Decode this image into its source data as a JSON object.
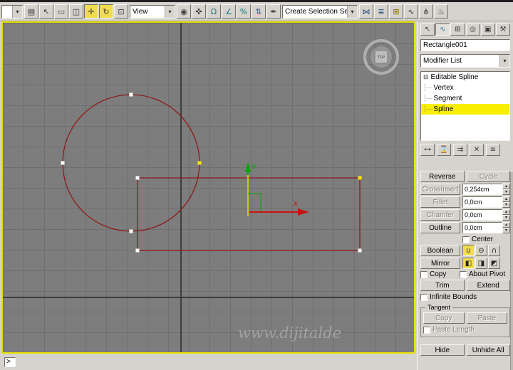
{
  "colors": {
    "viewport_border": "#e6df00",
    "spline_stroke": "#8e1b1b",
    "selected_vertex": "#f8e800",
    "selected_subobject_bg": "#f8f000",
    "active_button_bg": "#f0dc4e",
    "axis_x": "#cc1111",
    "axis_y": "#00a800"
  },
  "toolbar": {
    "filter_dropdown": {
      "value": ""
    },
    "view_dropdown": {
      "value": "View"
    },
    "selection_set_dropdown": {
      "value": "Create Selection Se"
    },
    "icons_a": [
      {
        "name": "select-by-name-icon",
        "glyph": "▤"
      },
      {
        "name": "select-object-icon",
        "glyph": "↖"
      },
      {
        "name": "rectangular-selection-region-icon",
        "glyph": "▭"
      },
      {
        "name": "window-crossing-icon",
        "glyph": "◫"
      },
      {
        "name": "select-and-move-icon",
        "glyph": "✛",
        "active": true
      },
      {
        "name": "select-and-rotate-icon",
        "glyph": "↻",
        "active": true
      },
      {
        "name": "select-and-scale-icon",
        "glyph": "⊡"
      }
    ],
    "icons_b": [
      {
        "name": "use-pivot-point-center-icon",
        "glyph": "◉"
      },
      {
        "name": "select-and-manipulate-icon",
        "glyph": "✜"
      },
      {
        "name": "snap-toggle-icon",
        "glyph": "Ω",
        "color": "#0e7e7e"
      },
      {
        "name": "angle-snap-icon",
        "glyph": "∠",
        "color": "#0e7e7e"
      },
      {
        "name": "percent-snap-icon",
        "glyph": "%",
        "color": "#0e7e7e"
      },
      {
        "name": "spinner-snap-icon",
        "glyph": "⇅",
        "color": "#0e7e7e"
      },
      {
        "name": "edit-named-selection-sets-icon",
        "glyph": "✒"
      }
    ],
    "icons_c": [
      {
        "name": "mirror-icon",
        "glyph": "⋈",
        "color": "#28527a"
      },
      {
        "name": "align-icon",
        "glyph": "≣",
        "color": "#28527a"
      },
      {
        "name": "layer-manager-icon",
        "glyph": "⊞",
        "color": "#8a6d00"
      },
      {
        "name": "curve-editor-icon",
        "glyph": "∿",
        "color": "#3a3a3a"
      },
      {
        "name": "schematic-view-icon",
        "glyph": "⋔",
        "color": "#3a3a3a"
      },
      {
        "name": "render-setup-icon",
        "glyph": "♨",
        "color": "#3a3a3a"
      }
    ]
  },
  "viewport": {
    "viewcube_label": "TOP",
    "axis_x_label": "x",
    "axis_y_label": "y",
    "watermark": "www.dijitalde"
  },
  "panel": {
    "tabs": [
      {
        "name": "create-tab",
        "glyph": "↖"
      },
      {
        "name": "modify-tab",
        "glyph": "∿",
        "active": true,
        "color": "#17728f"
      },
      {
        "name": "hierarchy-tab",
        "glyph": "⊞"
      },
      {
        "name": "motion-tab",
        "glyph": "◎"
      },
      {
        "name": "display-tab",
        "glyph": "▣"
      },
      {
        "name": "utilities-tab",
        "glyph": "⚒"
      }
    ],
    "object_name": "Rectangle001",
    "modifier_list_label": "Modifier List",
    "stack": {
      "root": "Editable Spline",
      "items": [
        "Vertex",
        "Segment",
        "Spline"
      ],
      "selected": "Spline"
    },
    "stack_tools": [
      {
        "name": "pin-stack-icon",
        "glyph": "⊶"
      },
      {
        "name": "show-end-result-icon",
        "glyph": "⌛"
      },
      {
        "name": "make-unique-icon",
        "glyph": "⇉"
      },
      {
        "name": "remove-modifier-icon",
        "glyph": "✕"
      },
      {
        "name": "configure-modifier-sets-icon",
        "glyph": "≡"
      }
    ],
    "boolean_icons": [
      {
        "name": "boolean-union-icon",
        "glyph": "∪",
        "active": true
      },
      {
        "name": "boolean-subtraction-icon",
        "glyph": "⊖"
      },
      {
        "name": "boolean-intersection-icon",
        "glyph": "∩"
      }
    ],
    "mirror_icons": [
      {
        "name": "mirror-horizontal-icon",
        "glyph": "◧",
        "active": true
      },
      {
        "name": "mirror-vertical-icon",
        "glyph": "◨"
      },
      {
        "name": "mirror-both-icon",
        "glyph": "◩"
      }
    ],
    "geometry": {
      "reverse": "Reverse",
      "cycle": "Cycle",
      "cross_insert": "CrossInsert",
      "cross_insert_value": "0,254cm",
      "fillet": "Fillet",
      "fillet_value": "0,0cm",
      "chamfer": "Chamfer",
      "chamfer_value": "0,0cm",
      "outline": "Outline",
      "outline_value": "0,0cm",
      "center": "Center",
      "boolean": "Boolean",
      "mirror": "Mirror",
      "copy": "Copy",
      "about_pivot": "About Pivot",
      "trim": "Trim",
      "extend": "Extend",
      "infinite_bounds": "Infinite Bounds",
      "tangent_title": "Tangent",
      "tangent_copy": "Copy",
      "tangent_paste": "Paste",
      "paste_length": "Paste Length",
      "hide": "Hide",
      "unhide_all": "Unhide All"
    }
  },
  "statusbar": {
    "prompt": ">"
  }
}
